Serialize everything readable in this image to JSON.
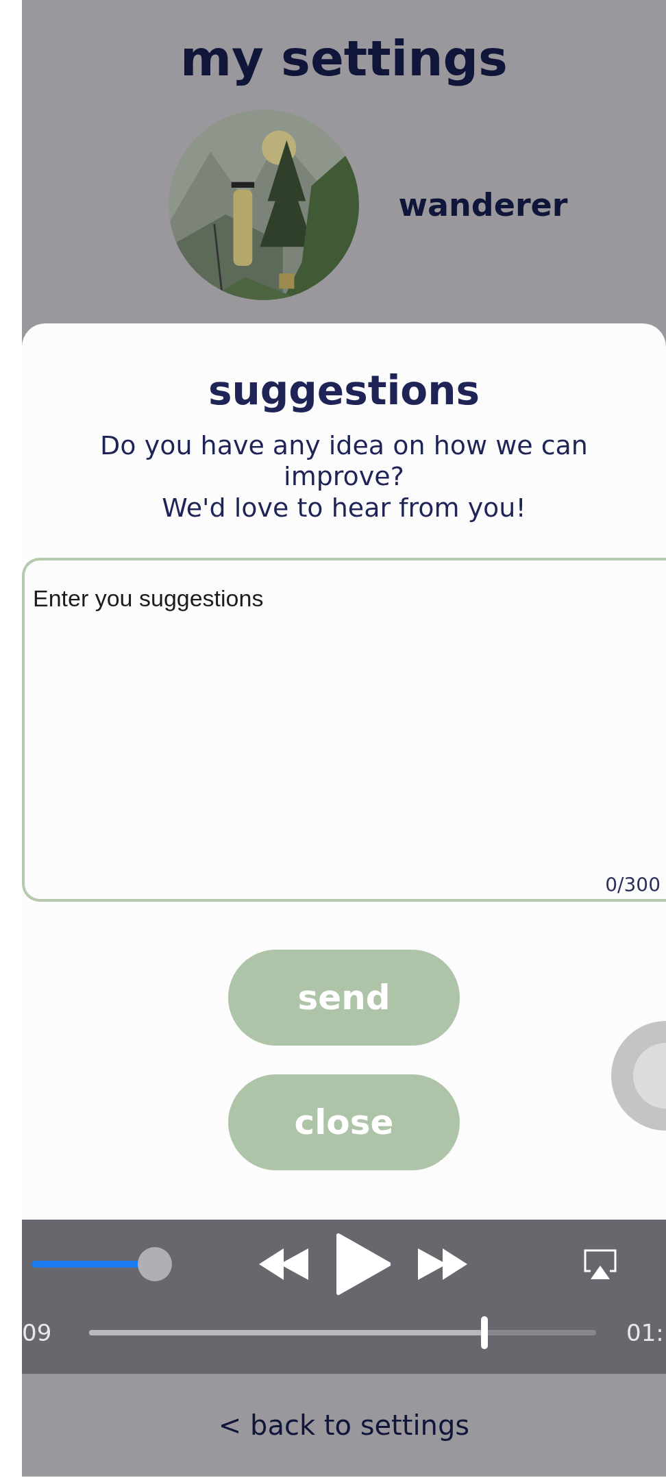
{
  "header": {
    "title": "my settings",
    "username": "wanderer"
  },
  "dialog": {
    "title": "suggestions",
    "message": "Do you have any idea on how we can improve?\nWe'd love to hear from you!",
    "field": {
      "placeholder": "Enter you suggestions",
      "counter": "0/300"
    },
    "buttons": [
      "send",
      "close"
    ]
  },
  "player": {
    "volume": {
      "level": 0.9
    },
    "elapsed": "09",
    "progress": {
      "level": 0.78
    },
    "remaining": "01:"
  },
  "footer": {
    "link": "< back to settings"
  }
}
